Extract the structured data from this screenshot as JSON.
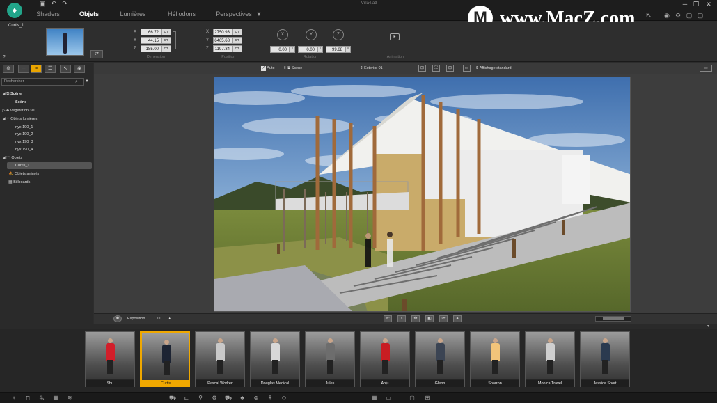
{
  "titlebar": {
    "title": "Villa4.atl",
    "tabs": [
      {
        "label": "Shaders"
      },
      {
        "label": "Objets"
      },
      {
        "label": "Lumières"
      },
      {
        "label": "Héliodons"
      },
      {
        "label": "Perspectives"
      }
    ],
    "tab_dropdown": "▼"
  },
  "watermark": {
    "text": "www.MacZ.com"
  },
  "properties": {
    "object_name": "Curtis_1",
    "dimension": {
      "label": "Dimension",
      "x": "66.72",
      "y": "44.15",
      "z": "185.00",
      "unit": "cm"
    },
    "position": {
      "label": "Position",
      "x": "2750.93",
      "y": "6465.68",
      "z": "1197.34",
      "unit": "cm"
    },
    "rotation": {
      "label": "Rotation",
      "x": "0.00",
      "y": "0.00",
      "z": "99.68",
      "unit": "°"
    },
    "animation": {
      "label": "Animation"
    },
    "axes": [
      "X",
      "Y",
      "Z"
    ],
    "help": "?"
  },
  "left_panel": {
    "search_placeholder": "Rechercher",
    "tree": [
      {
        "label": "Scène",
        "level": 0,
        "icon": "scene-icon",
        "expand": "◢"
      },
      {
        "label": "Scène",
        "level": 1,
        "icon": "",
        "expand": ""
      },
      {
        "label": "Végétation 3D",
        "level": 0,
        "icon": "tree-icon",
        "expand": "▷"
      },
      {
        "label": "Objets lumières",
        "level": 0,
        "icon": "lamp-icon",
        "expand": "◢"
      },
      {
        "label": "nyx 190_1",
        "level": 1,
        "icon": "",
        "expand": ""
      },
      {
        "label": "nyx 190_2",
        "level": 1,
        "icon": "",
        "expand": ""
      },
      {
        "label": "nyx 190_3",
        "level": 1,
        "icon": "",
        "expand": ""
      },
      {
        "label": "nyx 190_4",
        "level": 1,
        "icon": "",
        "expand": ""
      },
      {
        "label": "Objets",
        "level": 0,
        "icon": "cube-icon",
        "expand": "◢"
      },
      {
        "label": "Curtis_1",
        "level": 1,
        "icon": "",
        "expand": "",
        "selected": true
      },
      {
        "label": "Objets animés",
        "level": 0,
        "icon": "animated-icon",
        "expand": ""
      },
      {
        "label": "Billboards",
        "level": 0,
        "icon": "billboard-icon",
        "expand": ""
      }
    ]
  },
  "viewport": {
    "auto_label": "Auto",
    "scene_label": "Scène",
    "camera_label": "Exterior 01",
    "display_label": "Affichage standard",
    "exposure_label": "Exposition",
    "exposure_value": "1.00",
    "exposure_unit": "▲"
  },
  "library": {
    "items": [
      {
        "name": "Shu",
        "color": "#d21e2a"
      },
      {
        "name": "Curtis",
        "color": "#1d2433",
        "selected": true
      },
      {
        "name": "Pascal Worker",
        "color": "#c9c9c9"
      },
      {
        "name": "Douglas Medical",
        "color": "#d8d8d8"
      },
      {
        "name": "Jules",
        "color": "#6d6d6d"
      },
      {
        "name": "Anju",
        "color": "#c91d22"
      },
      {
        "name": "Glenn",
        "color": "#3b4453"
      },
      {
        "name": "Sharron",
        "color": "#f2c47a"
      },
      {
        "name": "Monica Travel",
        "color": "#cfcfcf"
      },
      {
        "name": "Jessica Sport",
        "color": "#2b3a4f"
      }
    ]
  }
}
